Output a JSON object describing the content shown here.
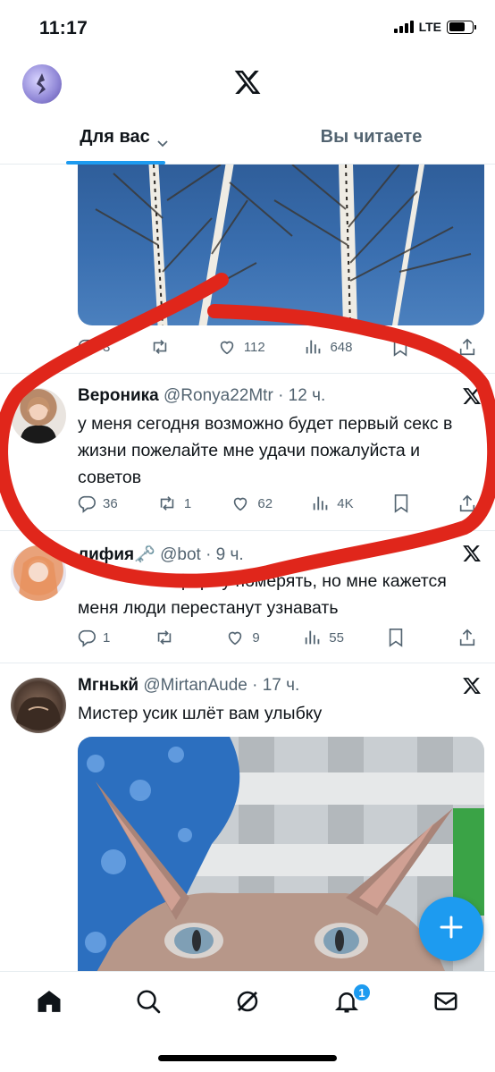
{
  "status_bar": {
    "time": "11:17",
    "network": "LTE"
  },
  "tabs": [
    {
      "label": "Для вас"
    },
    {
      "label": "Вы читаете"
    }
  ],
  "posts": [
    {
      "actions": {
        "reply": "3",
        "repost": "",
        "like": "112",
        "views": "648"
      }
    },
    {
      "name": "Вероника",
      "handle": "@Ronya22Mtr",
      "time": "· 12 ч.",
      "text": "у меня сегодня возможно будет первый секс в жизни пожелайте мне удачи пожалуйста и советов",
      "actions": {
        "reply": "36",
        "repost": "1",
        "like": "62",
        "views": "4K"
      }
    },
    {
      "name": "лифия🗝️",
      "handle": "@bot",
      "time": "· 9 ч.",
      "text": "форму померять, но мне кажется меня люди перестанут узнавать",
      "actions": {
        "reply": "1",
        "repost": "",
        "like": "9",
        "views": "55"
      }
    },
    {
      "name": "Мгнькй",
      "handle": "@MirtanAude",
      "time": "· 17 ч.",
      "text": "Мистер усик шлёт вам улыбку"
    }
  ],
  "bottom_nav": {
    "items": [
      "home-icon",
      "search-icon",
      "grok-icon",
      "bell-icon",
      "mail-icon"
    ],
    "notifications_badge": "1"
  },
  "colors": {
    "accent": "#1d9bf0",
    "annotation": "#e0261b"
  }
}
